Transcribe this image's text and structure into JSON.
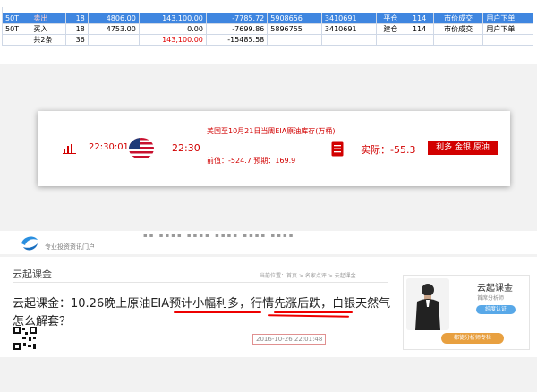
{
  "trade_table": {
    "rows": [
      {
        "code": "50T",
        "side": "卖出",
        "qty": "18",
        "price": "4806.00",
        "amount": "143,100.00",
        "pnl": "-7785.72",
        "order_no": "5908656",
        "deal_no": "3410691",
        "type": "平仓",
        "seat": "114",
        "order_type": "市价成交",
        "source": "用户下单"
      },
      {
        "code": "50T",
        "side": "买入",
        "qty": "18",
        "price": "4753.00",
        "amount": "0.00",
        "pnl": "-7699.86",
        "order_no": "5896755",
        "deal_no": "3410691",
        "type": "建仓",
        "seat": "114",
        "order_type": "市价成交",
        "source": "用户下单"
      }
    ],
    "total": {
      "label": "共2条",
      "qty": "36",
      "amount": "143,100.00",
      "pnl": "-15485.58"
    }
  },
  "calendar": {
    "time_published": "22:30:01",
    "time_scheduled": "22:30",
    "event": "美国至10月21日当周EIA原油库存(万桶)",
    "previous_label": "前值：",
    "previous": "-524.7",
    "forecast_label": "预期：",
    "forecast": "169.9",
    "actual_label": "实际：",
    "actual": "-55.3",
    "impact": "利多 金银 原油",
    "icons": [
      "bar-chart-icon",
      "us-flag-icon",
      "document-icon"
    ],
    "colors": {
      "accent": "#d20000"
    }
  },
  "site_header": {
    "tagline": "专业投资资讯门户"
  },
  "article": {
    "section": "云起课金",
    "breadcrumb": "当前位置：首页 > 名家点评 > 云起课金",
    "headline": "云起课金：10.26晚上原油EIA预计小幅利多，行情先涨后跌，白银天然气怎么解套？",
    "date": "2016-10-26 22:01:48"
  },
  "author": {
    "name": "云起课金",
    "role": "首席分析师",
    "verify": "纯度认证",
    "follow": "都徒分析师专栏"
  }
}
